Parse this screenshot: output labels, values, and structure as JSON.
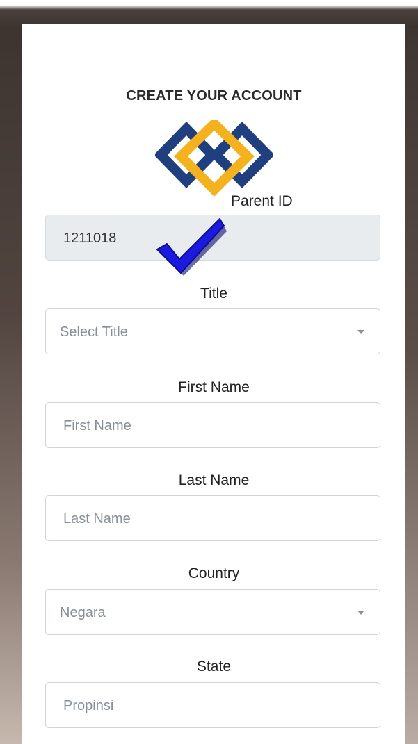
{
  "form": {
    "heading": "CREATE YOUR ACCOUNT",
    "logo_icon": "interlocking-diamonds-logo",
    "logo_colors": {
      "blue": "#1f3f7f",
      "gold": "#f4b21f"
    },
    "checkmark_icon": "blue-checkmark-icon",
    "checkmark_color": "#1a1ae0",
    "fields": {
      "parent_id": {
        "label": "Parent ID",
        "value": "1211018"
      },
      "title": {
        "label": "Title",
        "placeholder": "Select Title"
      },
      "first_name": {
        "label": "First Name",
        "placeholder": "First Name"
      },
      "last_name": {
        "label": "Last Name",
        "placeholder": "Last Name"
      },
      "country": {
        "label": "Country",
        "placeholder": "Negara"
      },
      "state": {
        "label": "State",
        "placeholder": "Propinsi"
      }
    }
  }
}
